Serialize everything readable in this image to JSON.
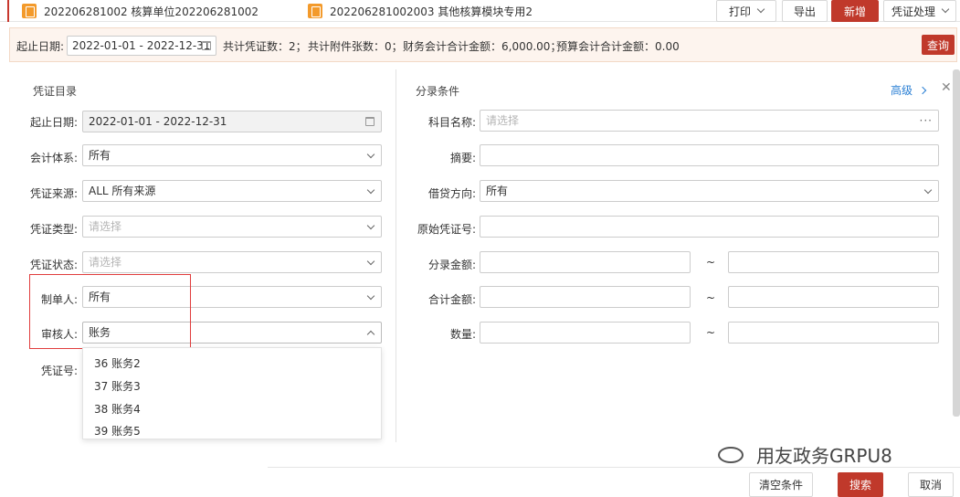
{
  "tabs": [
    {
      "label": "202206281002 核算单位202206281002"
    },
    {
      "label": "202206281002003 其他核算模块专用2"
    }
  ],
  "toolbar": {
    "print": "打印",
    "export": "导出",
    "add": "新增",
    "voucher_process": "凭证处理"
  },
  "summary": {
    "date_label": "起止日期:",
    "date_value": "2022-01-01 - 2022-12-31",
    "voucher_count": "共计凭证数：2；",
    "attachment_count": "共计附件张数：0；",
    "finance_total": "财务会计合计金额：6,000.00；",
    "budget_total": "预算会计合计金额：0.00",
    "query": "查询"
  },
  "left": {
    "title": "凭证目录",
    "fields": [
      {
        "label": "起止日期:",
        "value": "2022-01-01 - 2022-12-31"
      },
      {
        "label": "会计体系:",
        "value": "所有"
      },
      {
        "label": "凭证来源:",
        "value": "ALL 所有来源"
      },
      {
        "label": "凭证类型:",
        "placeholder": "请选择"
      },
      {
        "label": "凭证状态:",
        "placeholder": "请选择"
      },
      {
        "label": "制单人:",
        "value": "所有"
      },
      {
        "label": "审核人:",
        "value": "账务"
      },
      {
        "label": "凭证号:"
      }
    ],
    "dropdown": [
      "36 账务2",
      "37 账务3",
      "38 账务4",
      "39 账务5"
    ]
  },
  "right": {
    "title": "分录条件",
    "advanced": "高级",
    "fields": [
      {
        "label": "科目名称:",
        "placeholder": "请选择"
      },
      {
        "label": "摘要:"
      },
      {
        "label": "借贷方向:",
        "value": "所有"
      },
      {
        "label": "原始凭证号:"
      },
      {
        "label": "分录金额:"
      },
      {
        "label": "合计金额:"
      },
      {
        "label": "数量:"
      }
    ],
    "tilde": "~"
  },
  "footer": {
    "clear": "清空条件",
    "search": "搜索",
    "cancel": "取消"
  },
  "watermark": "用友政务GRPU8",
  "colors": {
    "accent": "#c0392b",
    "link": "#2a7fd4",
    "highlight": "#e03c3c"
  }
}
